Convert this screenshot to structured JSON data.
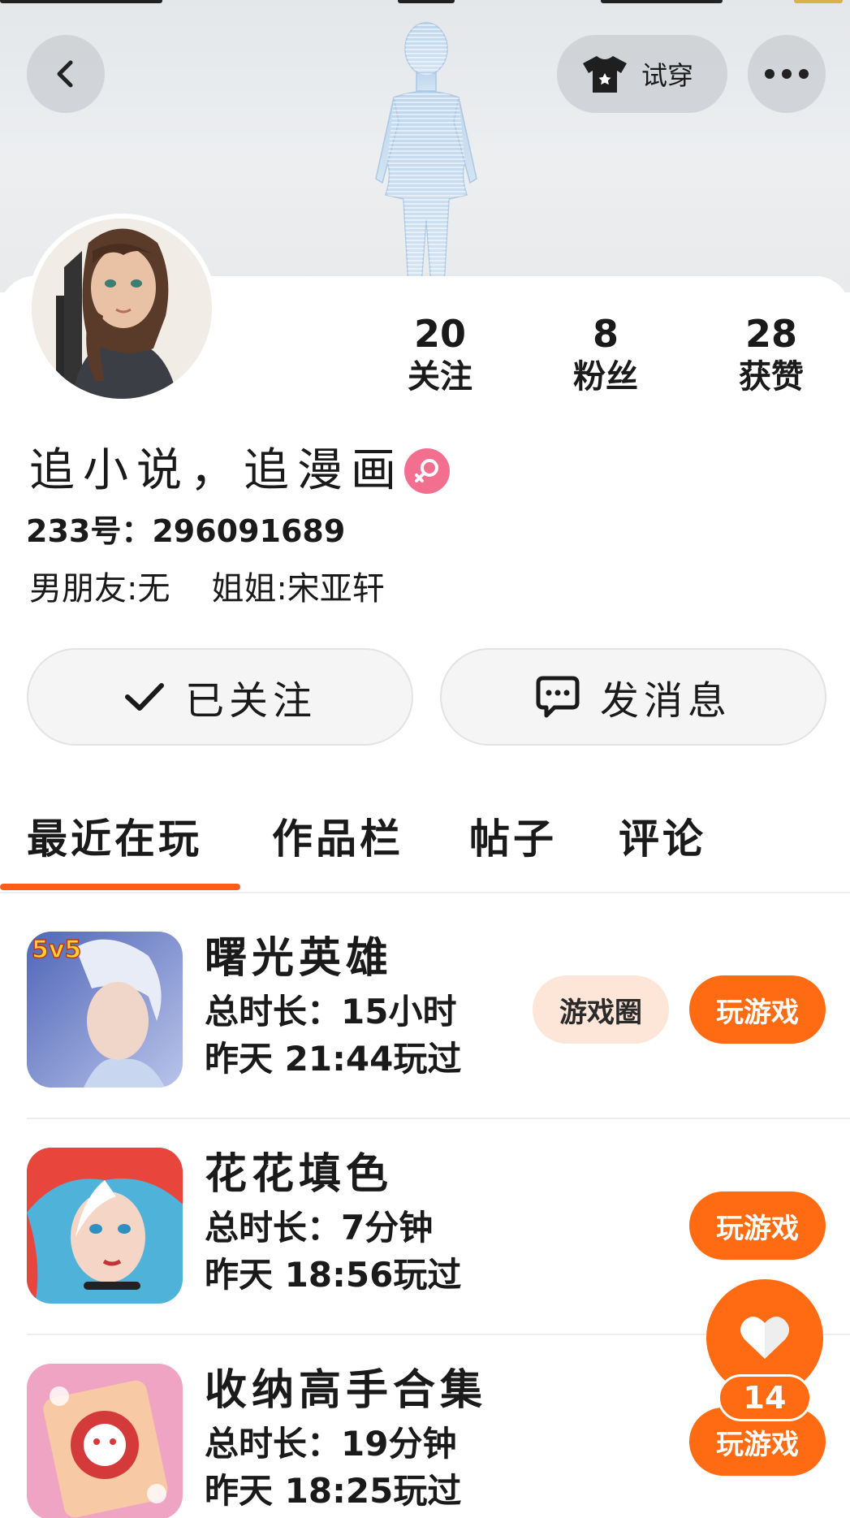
{
  "header": {
    "try_on_label": "试穿",
    "back_icon": "back-arrow-icon",
    "more_icon": "more-dots-icon",
    "tshirt_icon": "tshirt-icon"
  },
  "profile": {
    "stats": [
      {
        "value": "20",
        "label": "关注"
      },
      {
        "value": "8",
        "label": "粉丝"
      },
      {
        "value": "28",
        "label": "获赞"
      }
    ],
    "nickname": "追小说，追漫画",
    "gender_color": "#f36f8f",
    "uid": "233号：296091689",
    "bio": "男朋友:无    姐姐:宋亚轩"
  },
  "actions": {
    "follow_label": "已关注",
    "message_label": "发消息"
  },
  "tabs": [
    {
      "label": "最近在玩",
      "active": true
    },
    {
      "label": "作品栏",
      "active": false
    },
    {
      "label": "帖子",
      "active": false
    },
    {
      "label": "评论",
      "active": false
    }
  ],
  "games": [
    {
      "name": "曙光英雄",
      "duration": "总时长：15小时",
      "last_played": "昨天 21:44玩过",
      "circle_label": "游戏圈",
      "play_label": "玩游戏",
      "badge": "5v5"
    },
    {
      "name": "花花填色",
      "duration": "总时长：7分钟",
      "last_played": "昨天 18:56玩过",
      "play_label": "玩游戏"
    },
    {
      "name": "收纳高手合集",
      "duration": "总时长：19分钟",
      "last_played": "昨天 18:25玩过",
      "play_label": "玩游戏"
    }
  ],
  "like_fab": {
    "count": "14",
    "icon": "heart-icon"
  },
  "colors": {
    "accent": "#ff6b12",
    "tab_underline": "#ff5c1a",
    "circle_bg": "#fde6d8"
  }
}
